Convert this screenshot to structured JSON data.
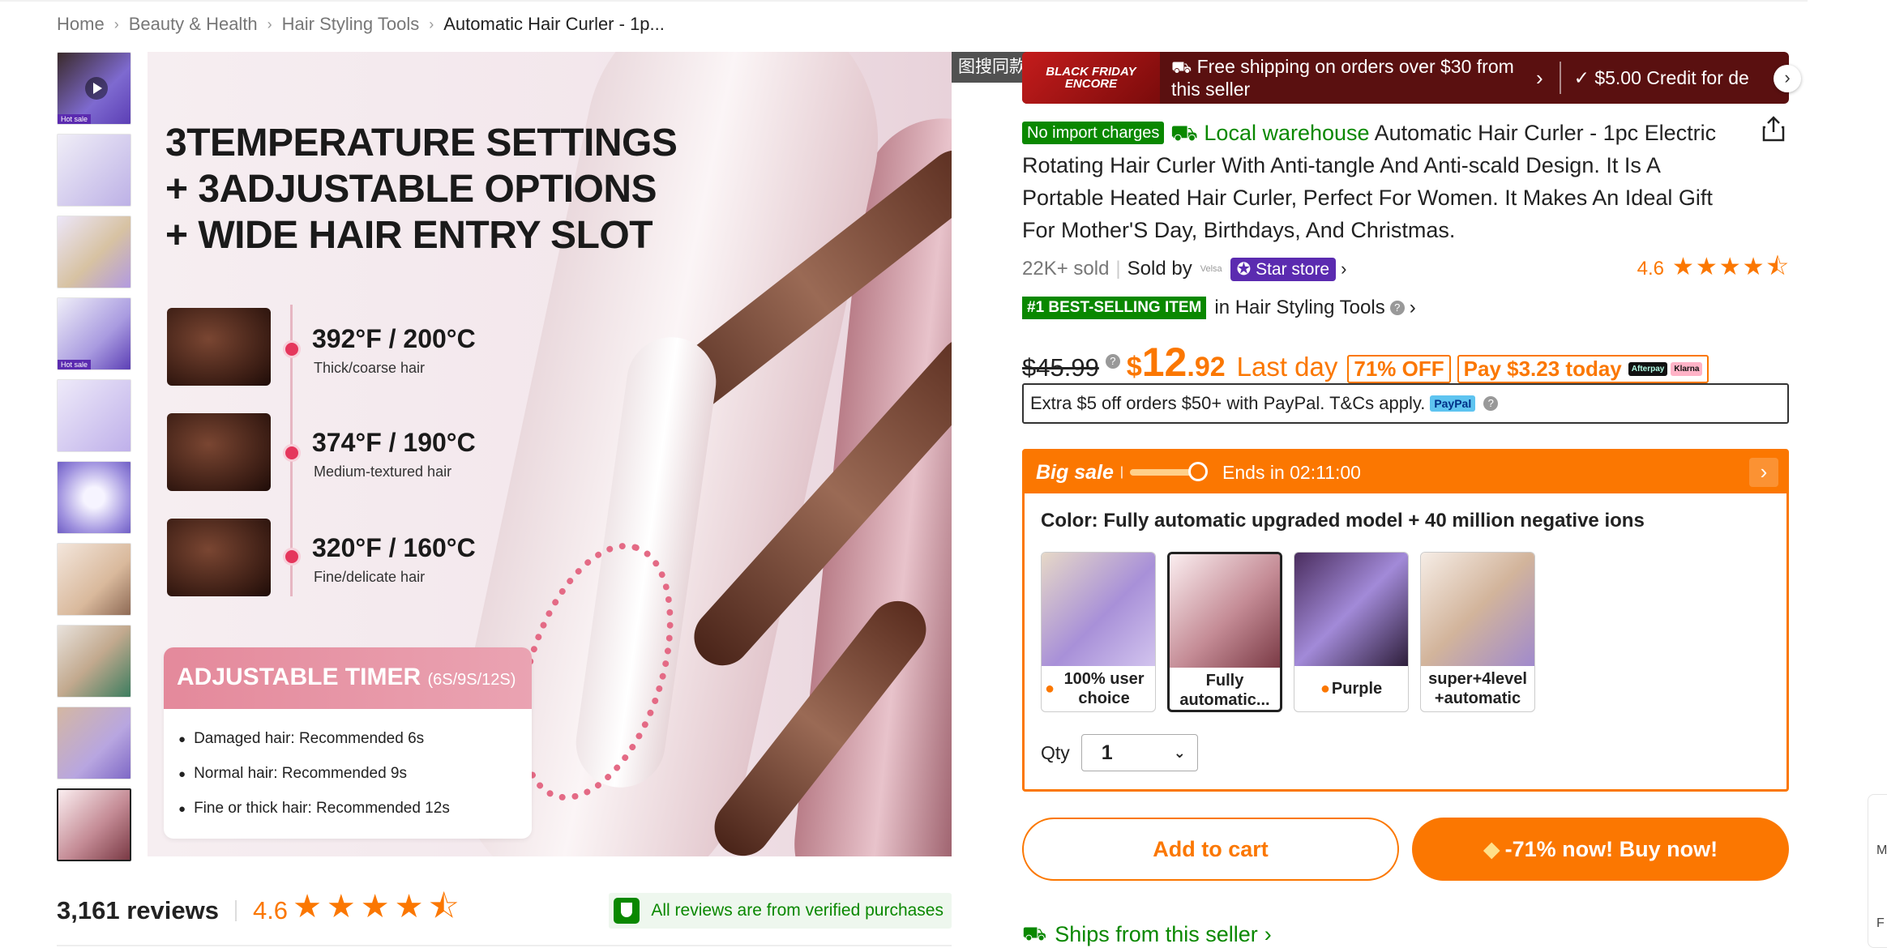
{
  "breadcrumb": {
    "items": [
      "Home",
      "Beauty & Health",
      "Hair Styling Tools"
    ],
    "current": "Automatic Hair Curler - 1p..."
  },
  "gallery": {
    "hot_label": "Hot sale",
    "main_image": {
      "headline_lines": [
        "3TEMPERATURE SETTINGS",
        "+ 3ADJUSTABLE OPTIONS",
        "+ WIDE HAIR ENTRY SLOT"
      ],
      "temps": [
        {
          "value": "392°F / 200°C",
          "desc": "Thick/coarse hair"
        },
        {
          "value": "374°F / 190°C",
          "desc": "Medium-textured hair"
        },
        {
          "value": "320°F / 160°C",
          "desc": "Fine/delicate hair"
        }
      ],
      "timer_title": "ADJUSTABLE TIMER",
      "timer_sub": "(6S/9S/12S)",
      "timer_items": [
        "Damaged hair: Recommended 6s",
        "Normal hair: Recommended 9s",
        "Fine or thick hair: Recommended 12s"
      ]
    },
    "search_tag": "图搜同款"
  },
  "reviews": {
    "count": "3,161 reviews",
    "rating": "4.6",
    "stars": "★★★★⯪",
    "verified": "All reviews are from verified purchases"
  },
  "banner": {
    "bf_line1": "BLACK FRIDAY",
    "bf_line2": "ENCORE",
    "shipping": "Free shipping on orders over $30 from this seller",
    "credit": "✓ $5.00 Credit for de"
  },
  "product": {
    "no_import": "No import charges",
    "local_warehouse": "Local warehouse",
    "title": "Automatic Hair Curler - 1pc Electric Rotating Hair Curler With Anti-tangle And Anti-scald Design. It Is A Portable Heated Hair Curler, Perfect For Women. It Makes An Ideal Gift For Mother'S Day, Birthdays, And Christmas.",
    "sold": "22K+ sold",
    "sold_by": "Sold by",
    "store_logo": "Velsa",
    "store_name": "Star store",
    "rating": "4.6",
    "stars": "★★★★⯪",
    "best_badge": "#1 BEST-SELLING ITEM",
    "best_category": "in Hair Styling Tools"
  },
  "price": {
    "old": "$45.99",
    "currency": "$",
    "main": "12",
    "cents": ".92",
    "last_day": "Last day",
    "off": "71% OFF",
    "pay_today": "Pay $3.23 today",
    "afterpay": "Afterpay",
    "klarna": "Klarna",
    "paypal_offer": "Extra $5 off orders $50+ with PayPal. T&Cs apply.",
    "paypal_logo": "PayPal"
  },
  "sale": {
    "title": "Big sale",
    "ends": "Ends in 02:11:00",
    "color_label": "Color: Fully automatic upgraded model + 40 million negative ions",
    "options": [
      {
        "label": "100% user choice",
        "drop": true
      },
      {
        "label": "Fully automatic...",
        "drop": false
      },
      {
        "label": "Purple",
        "drop": true
      },
      {
        "label": "super+4level +automatic",
        "drop": false
      }
    ],
    "qty_label": "Qty",
    "qty_value": "1"
  },
  "actions": {
    "add_to_cart": "Add to cart",
    "buy_now": "-71% now! Buy now!",
    "ships_from": "Ships from this seller"
  },
  "side_tab": {
    "a": "M",
    "b": "F"
  },
  "colors": {
    "accent": "#fb7701",
    "green": "#0a8800",
    "store_purple": "#5b2bb0",
    "banner_red": "#5a1010"
  }
}
